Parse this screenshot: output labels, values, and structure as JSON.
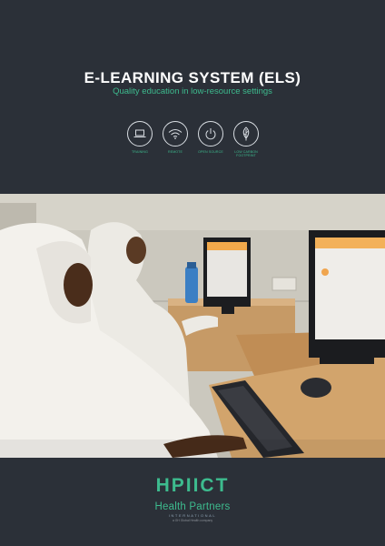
{
  "header": {
    "title": "E-LEARNING SYSTEM (ELS)",
    "subtitle": "Quality education in low-resource settings"
  },
  "features": [
    {
      "label": "TRAINING",
      "icon": "laptop-icon"
    },
    {
      "label": "REMOTE",
      "icon": "wifi-icon"
    },
    {
      "label": "OPEN SOURCE",
      "icon": "power-icon"
    },
    {
      "label": "LOW CARBON FOOTPRINT",
      "icon": "leaf-icon"
    }
  ],
  "footer": {
    "logo": "HPIICT",
    "partner_name": "Health Partners",
    "partner_sub": "INTERNATIONAL",
    "partner_tag": "a GH Global Health company"
  },
  "colors": {
    "background": "#2b3038",
    "accent": "#3dbb8e",
    "text": "#ffffff"
  }
}
